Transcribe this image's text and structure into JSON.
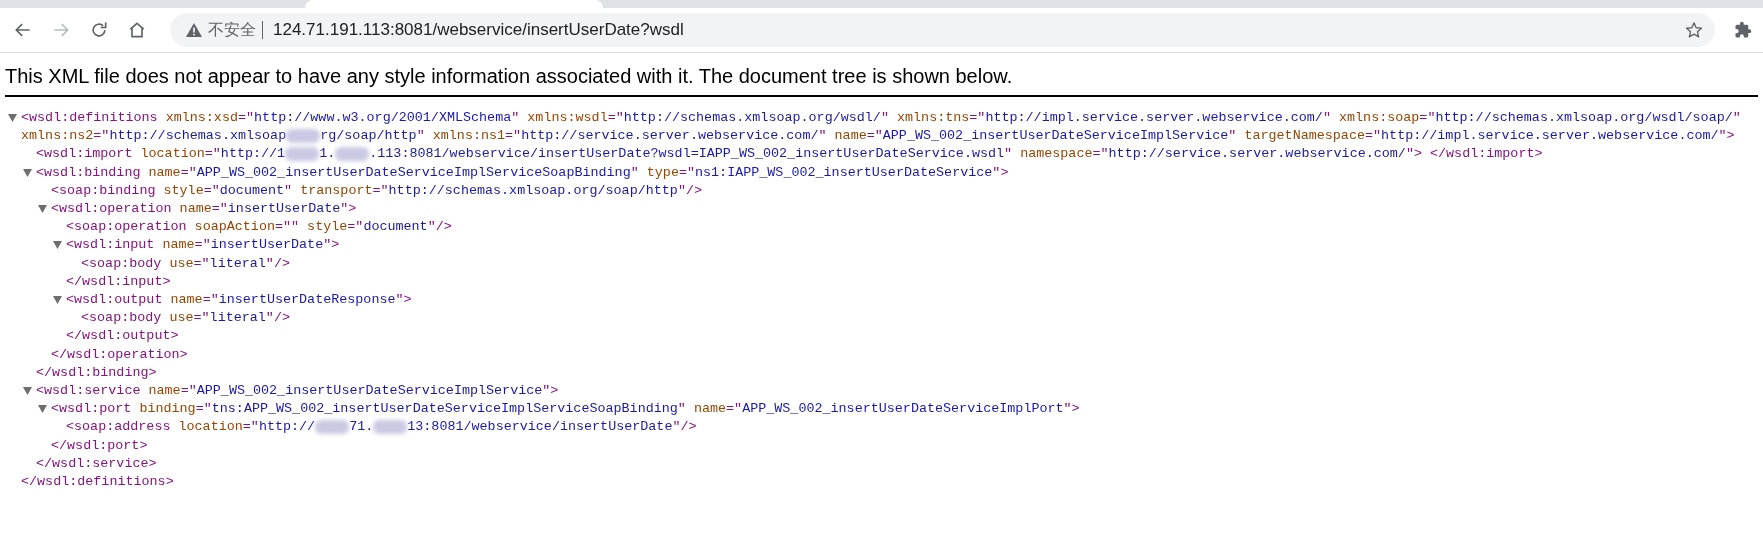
{
  "toolbar": {
    "nav_buttons": [
      {
        "kind": "back",
        "disabled": false
      },
      {
        "kind": "forward",
        "disabled": true
      },
      {
        "kind": "reload",
        "disabled": false
      },
      {
        "kind": "home",
        "disabled": false
      }
    ],
    "address_bar": {
      "security_label": "不安全",
      "url": "124.71.191.113:8081/webservice/insertUserDate?wsdl"
    }
  },
  "notice": "This XML file does not appear to have any style information associated with it. The document tree is shown below.",
  "xml_tree": [
    {
      "kind": "element",
      "expanded": true,
      "open_tag_parts": [
        {
          "kind": "text",
          "text": "<wsdl:definitions xmlns:xsd=\"http://www.w3.org/2001/XMLSchema\" xmlns:wsdl=\"http://schemas.xmlsoap.org/wsdl/\" xmlns:tns=\"http://impl.service.server.webservice.com/\" xmlns:soap=\"http://schemas.xmlsoap.org/wsdl/soap/\" xmlns:ns2=\"http://schemas.xmlsoap"
        },
        {
          "kind": "redacted"
        },
        {
          "kind": "text",
          "text": "rg/soap/http\" xmlns:ns1=\"http://service.server.webservice.com/\" name=\"APP_WS_002_insertUserDateServiceImplService\" targetNamespace=\"http://impl.service.server.webservice.com/\">"
        }
      ],
      "close_tag": "</wsdl:definitions>",
      "children": [
        {
          "kind": "leaf",
          "open_tag_parts": [
            {
              "kind": "text",
              "text": "<wsdl:import location=\"http://1"
            },
            {
              "kind": "redacted"
            },
            {
              "kind": "text",
              "text": "1."
            },
            {
              "kind": "redacted"
            },
            {
              "kind": "text",
              "text": ".113:8081/webservice/insertUserDate?wsdl=IAPP_WS_002_insertUserDateService.wsdl\" namespace=\"http://service.server.webservice.com/\"> </wsdl:import>"
            }
          ]
        },
        {
          "kind": "element",
          "expanded": true,
          "open_tag": "<wsdl:binding name=\"APP_WS_002_insertUserDateServiceImplServiceSoapBinding\" type=\"ns1:IAPP_WS_002_insertUserDateService\">",
          "close_tag": "</wsdl:binding>",
          "children": [
            {
              "kind": "leaf",
              "open_tag": "<soap:binding style=\"document\" transport=\"http://schemas.xmlsoap.org/soap/http\"/>"
            },
            {
              "kind": "element",
              "expanded": true,
              "open_tag": "<wsdl:operation name=\"insertUserDate\">",
              "close_tag": "</wsdl:operation>",
              "children": [
                {
                  "kind": "leaf",
                  "open_tag": "<soap:operation soapAction=\"\" style=\"document\"/>"
                },
                {
                  "kind": "element",
                  "expanded": true,
                  "open_tag": "<wsdl:input name=\"insertUserDate\">",
                  "close_tag": "</wsdl:input>",
                  "children": [
                    {
                      "kind": "leaf",
                      "open_tag": "<soap:body use=\"literal\"/>"
                    }
                  ]
                },
                {
                  "kind": "element",
                  "expanded": true,
                  "open_tag": "<wsdl:output name=\"insertUserDateResponse\">",
                  "close_tag": "</wsdl:output>",
                  "children": [
                    {
                      "kind": "leaf",
                      "open_tag": "<soap:body use=\"literal\"/>"
                    }
                  ]
                }
              ]
            }
          ]
        },
        {
          "kind": "element",
          "expanded": true,
          "open_tag": "<wsdl:service name=\"APP_WS_002_insertUserDateServiceImplService\">",
          "close_tag": "</wsdl:service>",
          "children": [
            {
              "kind": "element",
              "expanded": true,
              "open_tag": "<wsdl:port binding=\"tns:APP_WS_002_insertUserDateServiceImplServiceSoapBinding\" name=\"APP_WS_002_insertUserDateServiceImplPort\">",
              "close_tag": "</wsdl:port>",
              "children": [
                {
                  "kind": "leaf",
                  "open_tag_parts": [
                    {
                      "kind": "text",
                      "text": "<soap:address location=\"http://"
                    },
                    {
                      "kind": "redacted"
                    },
                    {
                      "kind": "text",
                      "text": "71."
                    },
                    {
                      "kind": "redacted"
                    },
                    {
                      "kind": "text",
                      "text": "13:8081/webservice/insertUserDate\"/>"
                    }
                  ]
                }
              ]
            }
          ]
        }
      ]
    }
  ]
}
